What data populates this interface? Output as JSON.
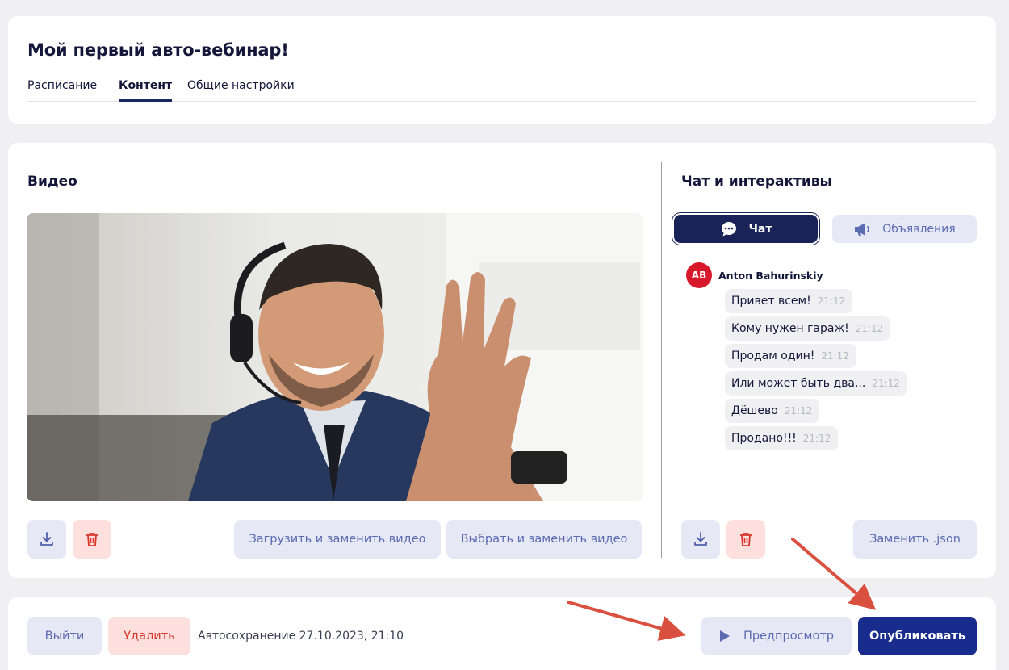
{
  "header": {
    "title": "Мой первый авто-вебинар!",
    "tabs": [
      {
        "label": "Расписание",
        "active": false
      },
      {
        "label": "Контент",
        "active": true
      },
      {
        "label": "Общие настройки",
        "active": false
      }
    ]
  },
  "video_section": {
    "title": "Видео",
    "upload_replace_label": "Загрузить и заменить видео",
    "select_replace_label": "Выбрать и заменить видео"
  },
  "chat_section": {
    "title": "Чат и интерактивы",
    "tab_chat_label": "Чат",
    "tab_announcements_label": "Объявления",
    "author": {
      "initials": "AB",
      "name": "Anton Bahurinskiy"
    },
    "messages": [
      {
        "text": "Привет всем!",
        "time": "21:12"
      },
      {
        "text": "Кому нужен гараж!",
        "time": "21:12"
      },
      {
        "text": "Продам один!",
        "time": "21:12"
      },
      {
        "text": "Или может быть два...",
        "time": "21:12"
      },
      {
        "text": "Дёшево",
        "time": "21:12"
      },
      {
        "text": "Продано!!!",
        "time": "21:12"
      }
    ],
    "replace_json_label": "Заменить .json"
  },
  "footer": {
    "exit_label": "Выйти",
    "delete_label": "Удалить",
    "autosave_text": "Автосохранение 27.10.2023, 21:10",
    "preview_label": "Предпросмотр",
    "publish_label": "Опубликовать"
  },
  "colors": {
    "primary": "#172c8c",
    "chat_active": "#1a2358",
    "light_button": "#e6e8f6",
    "danger_bg": "#fde0dd",
    "danger": "#d8362b",
    "avatar": "#d8182b",
    "arrow": "#d9503f"
  }
}
